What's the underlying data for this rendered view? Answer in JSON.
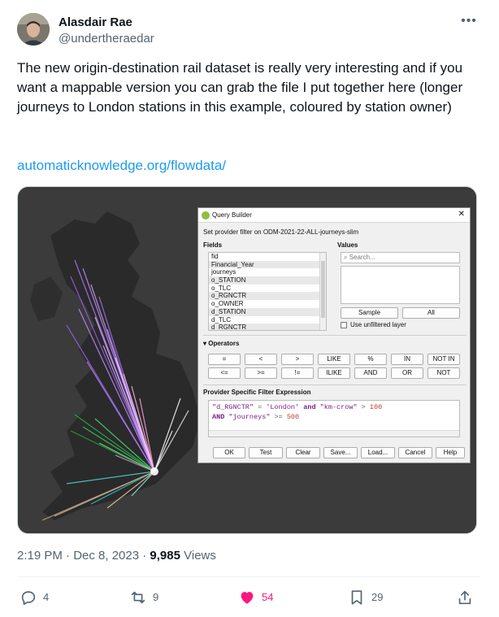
{
  "author": {
    "name": "Alasdair Rae",
    "handle": "@undertheraedar"
  },
  "tweet": {
    "text": "The new origin-destination rail dataset is really very interesting and if you want a mappable version you can grab the file I put together here (longer journeys to London stations in this example, coloured by station owner)",
    "link": "automaticknowledge.org/flowdata/"
  },
  "dialog": {
    "title": "Query Builder",
    "subtitle": "Set provider filter on ODM-2021-22-ALL-journeys-slim",
    "fields_label": "Fields",
    "values_label": "Values",
    "fields": [
      "fid",
      "Financial_Year",
      "journeys",
      "o_STATION",
      "o_TLC",
      "o_RGNCTR",
      "o_OWNER",
      "d_STATION",
      "d_TLC",
      "d_RGNCTR"
    ],
    "search_placeholder": "Search...",
    "sample_label": "Sample",
    "all_label": "All",
    "unfiltered_label": "Use unfiltered layer",
    "operators_label": "Operators",
    "operators_row1": [
      "=",
      "<",
      ">",
      "LIKE",
      "%",
      "IN",
      "NOT IN"
    ],
    "operators_row2": [
      "<=",
      ">=",
      "!=",
      "ILIKE",
      "AND",
      "OR",
      "NOT"
    ],
    "expression_label": "Provider Specific Filter Expression",
    "expr": {
      "f1": "\"d_RGNCTR\"",
      "eq": " = ",
      "s1": "'London'",
      "and1": " and ",
      "f2": "\"km-crow\"",
      "gt": " > ",
      "n1": "100",
      "and2": "AND",
      "f3": " \"journeys\"",
      "gte": " >= ",
      "n2": "500"
    },
    "buttons": [
      "OK",
      "Test",
      "Clear",
      "Save...",
      "Load...",
      "Cancel",
      "Help"
    ]
  },
  "footer": {
    "time": "2:19 PM · Dec 8, 2023 · ",
    "views_count": "9,985",
    "views_label": " Views"
  },
  "actions": {
    "replies": "4",
    "reposts": "9",
    "likes": "54",
    "bookmarks": "29"
  },
  "colors": {
    "link": "#1d9bf0",
    "like": "#f91880",
    "secondary": "#536471"
  }
}
